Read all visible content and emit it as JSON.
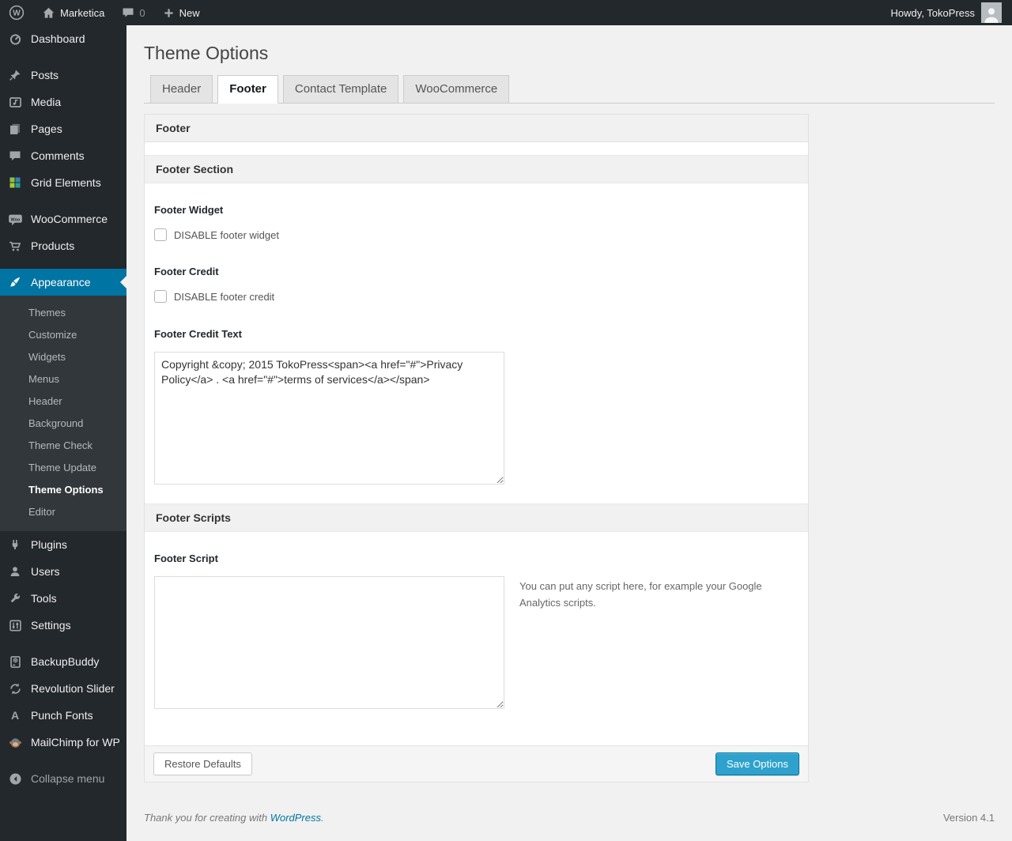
{
  "admin_bar": {
    "site_name": "Marketica",
    "comment_count": "0",
    "new_label": "New",
    "howdy_text": "Howdy, TokoPress"
  },
  "icons": {
    "wp_logo_letter": "W",
    "woo_badge_text": "Woo",
    "punch_fonts_glyph": "A"
  },
  "sidebar": {
    "items": [
      {
        "label": "Dashboard"
      },
      {
        "label": "Posts"
      },
      {
        "label": "Media"
      },
      {
        "label": "Pages"
      },
      {
        "label": "Comments"
      },
      {
        "label": "Grid Elements"
      },
      {
        "label": "WooCommerce"
      },
      {
        "label": "Products"
      },
      {
        "label": "Appearance"
      },
      {
        "label": "Plugins"
      },
      {
        "label": "Users"
      },
      {
        "label": "Tools"
      },
      {
        "label": "Settings"
      },
      {
        "label": "BackupBuddy"
      },
      {
        "label": "Revolution Slider"
      },
      {
        "label": "Punch Fonts"
      },
      {
        "label": "MailChimp for WP"
      }
    ],
    "submenu": [
      "Themes",
      "Customize",
      "Widgets",
      "Menus",
      "Header",
      "Background",
      "Theme Check",
      "Theme Update",
      "Theme Options",
      "Editor"
    ],
    "collapse_label": "Collapse menu"
  },
  "page": {
    "title": "Theme Options",
    "tabs": [
      "Header",
      "Footer",
      "Contact Template",
      "WooCommerce"
    ],
    "active_tab": "Footer"
  },
  "form": {
    "panel_title": "Footer",
    "section_title": "Footer Section",
    "footer_widget": {
      "label": "Footer Widget",
      "checkbox_label": "DISABLE footer widget",
      "checked": false
    },
    "footer_credit": {
      "label": "Footer Credit",
      "checkbox_label": "DISABLE footer credit",
      "checked": false
    },
    "footer_credit_text": {
      "label": "Footer Credit Text",
      "value": "Copyright &copy; 2015 TokoPress<span><a href=\"#\">Privacy Policy</a> . <a href=\"#\">terms of services</a></span>"
    },
    "scripts_section_title": "Footer Scripts",
    "footer_script": {
      "label": "Footer Script",
      "value": "",
      "help": "You can put any script here, for example your Google Analytics scripts."
    },
    "restore_button": "Restore Defaults",
    "save_button": "Save Options"
  },
  "colors": {
    "accent": "#0074a2",
    "primary_button": "#2ea2cc",
    "sidebar_bg": "#23282d",
    "submenu_bg": "#32373c",
    "content_bg": "#f1f1f1"
  },
  "footer": {
    "thanks_prefix": "Thank you for creating with",
    "wordpress_link": "WordPress",
    "suffix": ".",
    "version": "Version 4.1"
  }
}
